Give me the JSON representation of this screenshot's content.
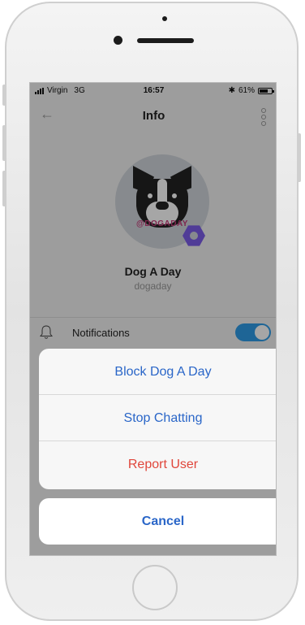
{
  "status_bar": {
    "carrier": "Virgin",
    "network": "3G",
    "time": "16:57",
    "bluetooth": "✱",
    "battery_pct": "61%"
  },
  "nav": {
    "title": "Info",
    "back_icon": "back-arrow-icon",
    "more_icon": "more-vertical-icon"
  },
  "profile": {
    "name": "Dog A Day",
    "handle": "dogaday",
    "avatar_text": "@DOGADAY"
  },
  "settings": {
    "notifications_label": "Notifications",
    "notifications_on": true
  },
  "action_sheet": {
    "actions": [
      {
        "label": "Block Dog A Day",
        "destructive": false
      },
      {
        "label": "Stop Chatting",
        "destructive": false
      },
      {
        "label": "Report User",
        "destructive": true
      }
    ],
    "cancel_label": "Cancel"
  },
  "colors": {
    "accent": "#2a66c8",
    "destructive": "#e0463b",
    "toggle": "#2f9ce6",
    "badge": "#7c5ce8"
  }
}
